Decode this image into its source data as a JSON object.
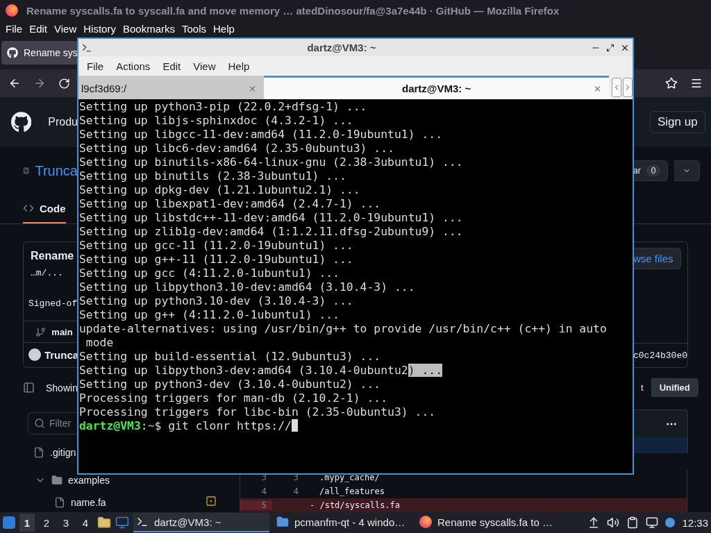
{
  "firefox": {
    "title": "Rename syscalls.fa to syscall.fa and move memory … atedDinosour/fa@3a7e44b · GitHub — Mozilla Firefox",
    "menu": [
      "File",
      "Edit",
      "View",
      "History",
      "Bookmarks",
      "Tools",
      "Help"
    ],
    "tab": {
      "title": "Rename sys",
      "selected": true
    }
  },
  "github": {
    "nav_item": "Produ",
    "sign_up": "Sign up",
    "repo_name": "Trunca",
    "star_label": "ar",
    "star_count": "0",
    "code_tab": {
      "label": "Code",
      "selected": true
    },
    "commit": {
      "title": "Rename",
      "body": "…m/...",
      "signed_off": "Signed-of",
      "branch": "main",
      "author": "Trunca",
      "sha": "c0c24b30e0",
      "browse_button": "wse files"
    },
    "showing": "Showin",
    "view_toggle": [
      {
        "label": "t",
        "selected": false
      },
      {
        "label": "Unified",
        "selected": true
      }
    ],
    "filter": {
      "placeholder": "Filter"
    },
    "file_tree": [
      {
        "name": ".gitign",
        "kind": "file"
      },
      {
        "name": "examples",
        "kind": "folder",
        "expanded": true,
        "children": [
          {
            "name": "name.fa",
            "kind": "file",
            "modified": true
          }
        ]
      }
    ],
    "diff_lines": [
      {
        "old": "3",
        "new": "3",
        "text": ".mypy_cache/",
        "kind": "context"
      },
      {
        "old": "4",
        "new": "4",
        "text": "/all_features",
        "kind": "context"
      },
      {
        "old": "5",
        "text": "- /std/syscalls.fa",
        "kind": "removed"
      }
    ]
  },
  "terminal": {
    "title": "dartz@VM3: ~",
    "menu": [
      "File",
      "Actions",
      "Edit",
      "View",
      "Help"
    ],
    "tabs": [
      {
        "label": "l9cf3d69:/",
        "selected": false
      },
      {
        "label": "dartz@VM3: ~",
        "selected": true
      }
    ],
    "lines": [
      {
        "text": "Setting up python3-pip (22.0.2+dfsg-1) ..."
      },
      {
        "text": "Setting up libjs-sphinxdoc (4.3.2-1) ..."
      },
      {
        "text": "Setting up libgcc-11-dev:amd64 (11.2.0-19ubuntu1) ..."
      },
      {
        "text": "Setting up libc6-dev:amd64 (2.35-0ubuntu3) ..."
      },
      {
        "text": "Setting up binutils-x86-64-linux-gnu (2.38-3ubuntu1) ..."
      },
      {
        "text": "Setting up binutils (2.38-3ubuntu1) ..."
      },
      {
        "text": "Setting up dpkg-dev (1.21.1ubuntu2.1) ..."
      },
      {
        "text": "Setting up libexpat1-dev:amd64 (2.4.7-1) ..."
      },
      {
        "text": "Setting up libstdc++-11-dev:amd64 (11.2.0-19ubuntu1) ..."
      },
      {
        "text": "Setting up zlib1g-dev:amd64 (1:1.2.11.dfsg-2ubuntu9) ..."
      },
      {
        "text": "Setting up gcc-11 (11.2.0-19ubuntu1) ..."
      },
      {
        "text": "Setting up g++-11 (11.2.0-19ubuntu1) ..."
      },
      {
        "text": "Setting up gcc (4:11.2.0-1ubuntu1) ..."
      },
      {
        "text": "Setting up libpython3.10-dev:amd64 (3.10.4-3) ..."
      },
      {
        "text": "Setting up python3.10-dev (3.10.4-3) ..."
      },
      {
        "text": "Setting up g++ (4:11.2.0-1ubuntu1) ..."
      },
      {
        "text": "update-alternatives: using /usr/bin/g++ to provide /usr/bin/c++ (c++) in auto"
      },
      {
        "text": " mode"
      },
      {
        "text": "Setting up build-essential (12.9ubuntu3) ..."
      },
      {
        "text": "Setting up libpython3-dev:amd64 (3.10.4-0ubuntu2",
        "highlighted": ") ..."
      },
      {
        "text": "Setting up python3-dev (3.10.4-0ubuntu2) ..."
      },
      {
        "text": "Processing triggers for man-db (2.10.2-1) ..."
      },
      {
        "text": "Processing triggers for libc-bin (2.35-0ubuntu3) ..."
      }
    ],
    "prompt": {
      "user": "dartz@VM3",
      "separator": ":",
      "path": "~",
      "symbol": "$",
      "command": "git clonr https://"
    }
  },
  "taskbar": {
    "workspaces": [
      {
        "label": "1",
        "selected": true
      },
      {
        "label": "2",
        "selected": false
      },
      {
        "label": "3",
        "selected": false
      },
      {
        "label": "4",
        "selected": false
      }
    ],
    "tasks": [
      {
        "label": "dartz@VM3: ~",
        "selected": true,
        "kind": "terminal"
      },
      {
        "label": "pcmanfm-qt - 4 windo…",
        "selected": false,
        "kind": "folder"
      },
      {
        "label": "Rename syscalls.fa to …",
        "selected": false,
        "kind": "browser"
      }
    ],
    "clock": "12:33"
  }
}
